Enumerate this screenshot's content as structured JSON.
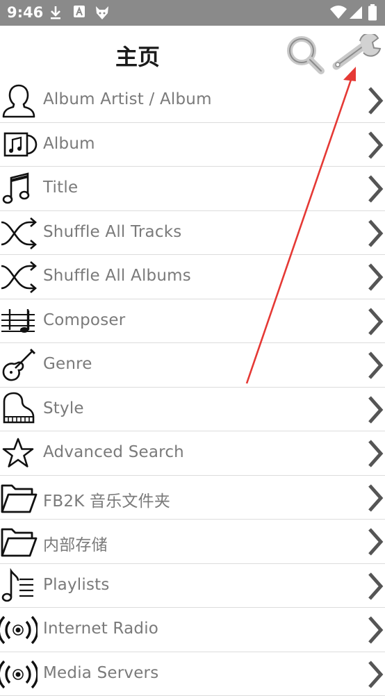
{
  "status_bar": {
    "time": "9:46",
    "icons": [
      "download-icon",
      "a-badge-icon",
      "fox-icon",
      "wifi-icon",
      "signal-icon",
      "battery-icon"
    ]
  },
  "header": {
    "title": "主页",
    "search_icon": "search-icon",
    "settings_icon": "wrench-icon"
  },
  "menu": {
    "items": [
      {
        "label": "Album Artist / Album",
        "icon": "person-icon"
      },
      {
        "label": "Album",
        "icon": "album-icon"
      },
      {
        "label": "Title",
        "icon": "music-note-icon"
      },
      {
        "label": "Shuffle All Tracks",
        "icon": "shuffle-icon"
      },
      {
        "label": "Shuffle All Albums",
        "icon": "shuffle-icon"
      },
      {
        "label": "Composer",
        "icon": "staff-icon"
      },
      {
        "label": "Genre",
        "icon": "violin-icon"
      },
      {
        "label": "Style",
        "icon": "piano-icon"
      },
      {
        "label": "Advanced Search",
        "icon": "star-icon"
      },
      {
        "label": "FB2K 音乐文件夹",
        "icon": "folder-icon"
      },
      {
        "label": "内部存储",
        "icon": "folder-icon"
      },
      {
        "label": "Playlists",
        "icon": "playlist-icon"
      },
      {
        "label": "Internet Radio",
        "icon": "radio-icon"
      },
      {
        "label": "Media Servers",
        "icon": "radio-icon"
      }
    ]
  },
  "colors": {
    "status_bar_bg": "#8a8a8a",
    "label": "#7a7a7a",
    "chevron": "#555555",
    "annotation_arrow": "#e53935"
  }
}
